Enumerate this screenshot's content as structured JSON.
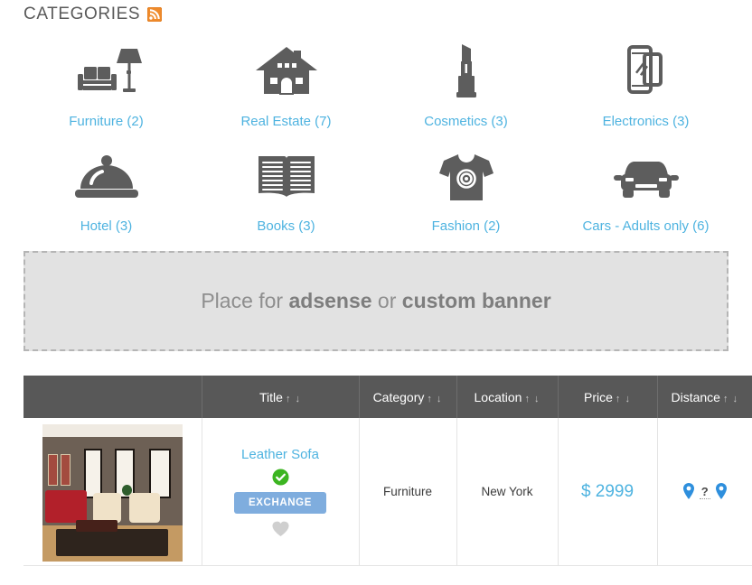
{
  "section": {
    "title": "CATEGORIES",
    "feed_icon": "rss-icon"
  },
  "categories": [
    {
      "label": "Furniture (2)",
      "icon": "sofa-lamp-icon"
    },
    {
      "label": "Real Estate (7)",
      "icon": "house-icon"
    },
    {
      "label": "Cosmetics (3)",
      "icon": "lipstick-icon"
    },
    {
      "label": "Electronics (3)",
      "icon": "smartphones-icon"
    },
    {
      "label": "Hotel (3)",
      "icon": "food-cloche-icon"
    },
    {
      "label": "Books (3)",
      "icon": "open-book-icon"
    },
    {
      "label": "Fashion (2)",
      "icon": "tshirt-icon"
    },
    {
      "label": "Cars - Adults only (6)",
      "icon": "car-icon"
    }
  ],
  "banner": {
    "text_before": "Place for ",
    "bold_one": "adsense",
    "text_middle": " or ",
    "bold_two": "custom banner"
  },
  "table": {
    "columns": [
      {
        "label": "",
        "sort": ""
      },
      {
        "label": "Title",
        "sort": "↑ ↓"
      },
      {
        "label": "Category",
        "sort": "↑ ↓"
      },
      {
        "label": "Location",
        "sort": "↑ ↓"
      },
      {
        "label": "Price",
        "sort": "↑ ↓"
      },
      {
        "label": "Distance",
        "sort": "↑ ↓"
      }
    ],
    "rows": [
      {
        "thumb_alt": "leather-sofa-living-room-photo",
        "title": "Leather Sofa",
        "verified_badge": "verified-check-icon",
        "action_label": "EXCHANGE",
        "favorite_icon": "heart-icon",
        "category": "Furniture",
        "location": "New York",
        "price": "$ 2999",
        "distance_help": "?"
      }
    ]
  },
  "colors": {
    "link_blue": "#4eb3e0",
    "header_gray": "#585858",
    "button_blue": "#7fadde",
    "verified_green": "#3cb521",
    "rss_orange": "#ef8b2c",
    "banner_bg": "#e2e2e2",
    "pin_blue": "#2e8fdd"
  }
}
